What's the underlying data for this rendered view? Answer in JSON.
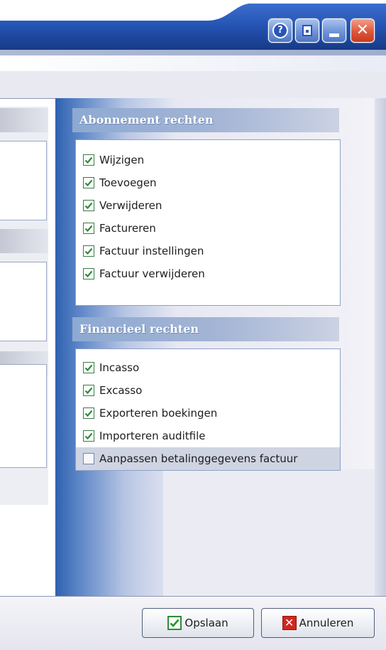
{
  "window": {
    "help_icon": "help-icon",
    "restore_icon": "restore-icon",
    "minimize_icon": "minimize-icon",
    "close_icon": "close-icon",
    "help_glyph": "?",
    "close_glyph": "✕"
  },
  "abonnement": {
    "title": "Abonnement rechten",
    "items": [
      {
        "label": "Wijzigen",
        "checked": true
      },
      {
        "label": "Toevoegen",
        "checked": true
      },
      {
        "label": "Verwijderen",
        "checked": true
      },
      {
        "label": "Factureren",
        "checked": true
      },
      {
        "label": "Factuur instellingen",
        "checked": true
      },
      {
        "label": "Factuur verwijderen",
        "checked": true
      }
    ]
  },
  "financieel": {
    "title": "Financieel rechten",
    "items": [
      {
        "label": "Incasso",
        "checked": true
      },
      {
        "label": "Excasso",
        "checked": true
      },
      {
        "label": "Exporteren boekingen",
        "checked": true
      },
      {
        "label": "Importeren auditfile",
        "checked": true
      },
      {
        "label": "Aanpassen betalinggegevens factuur",
        "checked": false
      }
    ]
  },
  "buttons": {
    "save_label": "Opslaan",
    "cancel_label": "Annuleren",
    "cancel_glyph": "✕"
  },
  "colors": {
    "titlebar_blue": "#1f4aa0",
    "panel_gradient_dark": "#2f61b0",
    "header_band": "#8da9d2",
    "close_red": "#e0563a",
    "check_green": "#2e8b3a"
  }
}
